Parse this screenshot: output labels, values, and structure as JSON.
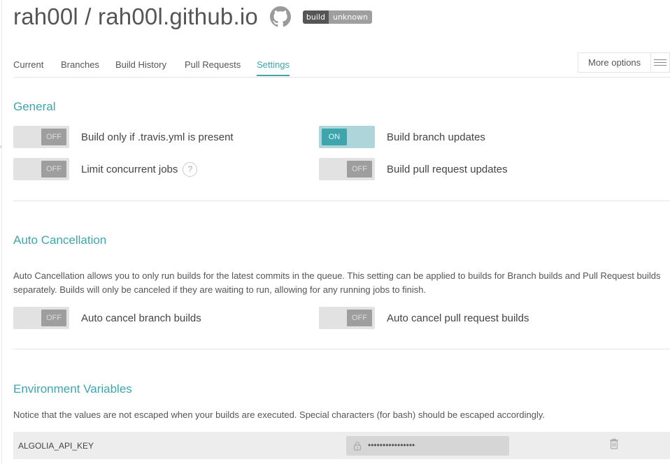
{
  "header": {
    "repo_title": "rah00l / rah00l.github.io",
    "badge": {
      "left": "build",
      "right": "unknown"
    }
  },
  "tabs": [
    {
      "label": "Current"
    },
    {
      "label": "Branches"
    },
    {
      "label": "Build History"
    },
    {
      "label": "Pull Requests"
    },
    {
      "label": "Settings",
      "active": true
    }
  ],
  "more_options": {
    "label": "More options"
  },
  "general": {
    "title": "General",
    "settings": [
      {
        "label": "Build only if .travis.yml is present",
        "state": "OFF"
      },
      {
        "label": "Build branch updates",
        "state": "ON"
      },
      {
        "label": "Limit concurrent jobs",
        "state": "OFF",
        "help": "?"
      },
      {
        "label": "Build pull request updates",
        "state": "OFF"
      }
    ]
  },
  "auto_cancellation": {
    "title": "Auto Cancellation",
    "description": "Auto Cancellation allows you to only run builds for the latest commits in the queue. This setting can be applied to builds for Branch builds and Pull Request builds separately. Builds will only be canceled if they are waiting to run, allowing for any running jobs to finish.",
    "settings": [
      {
        "label": "Auto cancel branch builds",
        "state": "OFF"
      },
      {
        "label": "Auto cancel pull request builds",
        "state": "OFF"
      }
    ]
  },
  "environment_variables": {
    "title": "Environment Variables",
    "notice": "Notice that the values are not escaped when your builds are executed. Special characters (for bash) should be escaped accordingly.",
    "variables": [
      {
        "name": "ALGOLIA_API_KEY",
        "value": "••••••••••••••••"
      }
    ]
  },
  "colors": {
    "accent": "#3ea5ad",
    "toggle_off": "#9e9e9e",
    "toggle_on_bg": "#aed6da"
  },
  "icons": [
    "github-icon",
    "menu-icon",
    "help-icon",
    "lock-icon",
    "trash-icon"
  ]
}
